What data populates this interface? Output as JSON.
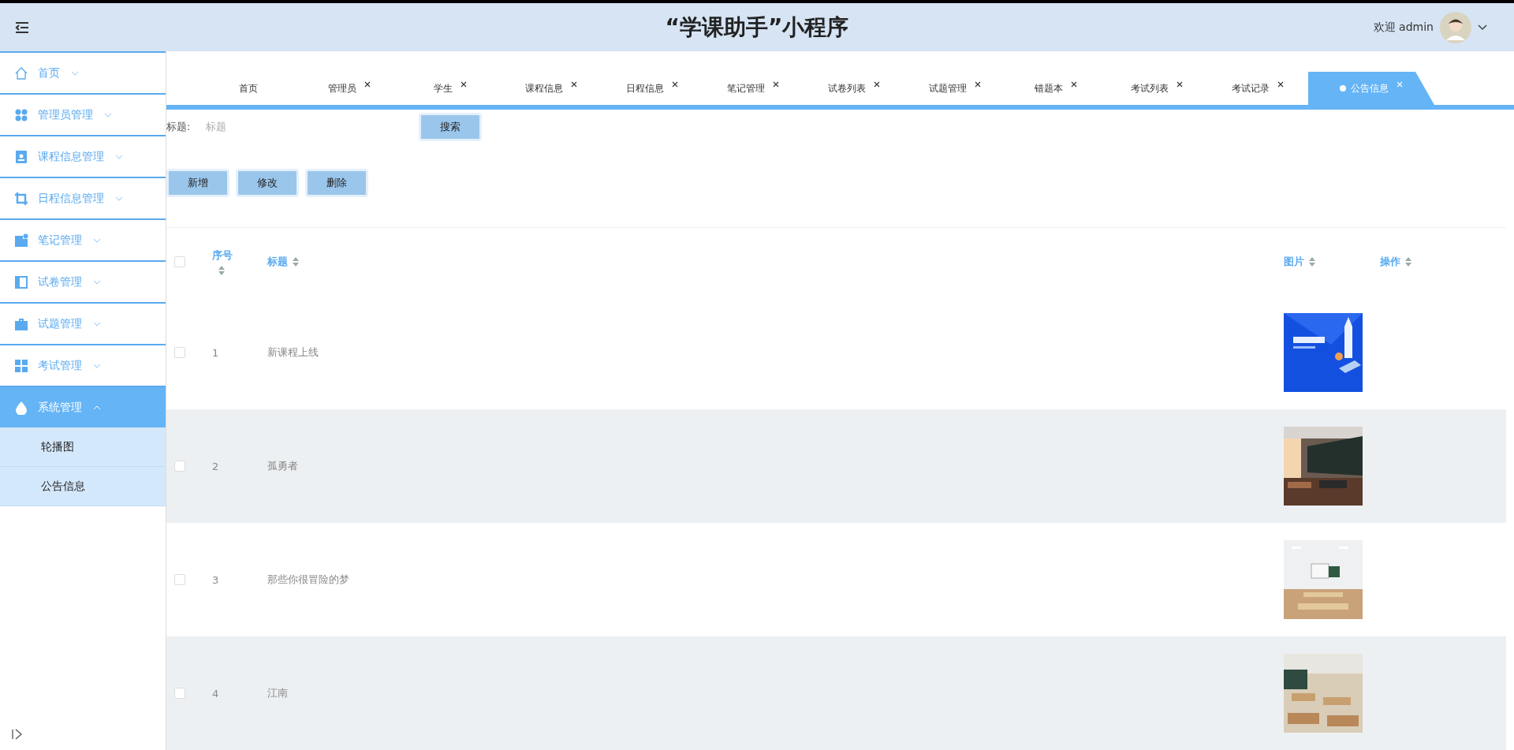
{
  "header": {
    "title": "“学课助手”小程序",
    "welcome": "欢迎 admin"
  },
  "sidebar": {
    "items": [
      {
        "label": "首页",
        "expanded": false
      },
      {
        "label": "管理员管理",
        "expanded": false
      },
      {
        "label": "课程信息管理",
        "expanded": false
      },
      {
        "label": "日程信息管理",
        "expanded": false
      },
      {
        "label": "笔记管理",
        "expanded": false
      },
      {
        "label": "试卷管理",
        "expanded": false
      },
      {
        "label": "试题管理",
        "expanded": false
      },
      {
        "label": "考试管理",
        "expanded": false
      },
      {
        "label": "系统管理",
        "expanded": true,
        "children": [
          {
            "label": "轮播图",
            "selected": false
          },
          {
            "label": "公告信息",
            "selected": false
          }
        ]
      }
    ]
  },
  "tabs": [
    {
      "label": "首页",
      "closable": false,
      "selected": false
    },
    {
      "label": "管理员",
      "closable": true,
      "selected": false
    },
    {
      "label": "学生",
      "closable": true,
      "selected": false
    },
    {
      "label": "课程信息",
      "closable": true,
      "selected": false
    },
    {
      "label": "日程信息",
      "closable": true,
      "selected": false
    },
    {
      "label": "笔记管理",
      "closable": true,
      "selected": false
    },
    {
      "label": "试卷列表",
      "closable": true,
      "selected": false
    },
    {
      "label": "试题管理",
      "closable": true,
      "selected": false
    },
    {
      "label": "错题本",
      "closable": true,
      "selected": false
    },
    {
      "label": "考试列表",
      "closable": true,
      "selected": false
    },
    {
      "label": "考试记录",
      "closable": true,
      "selected": false
    },
    {
      "label": "公告信息",
      "closable": true,
      "selected": true
    }
  ],
  "search": {
    "label": "标题:",
    "placeholder": "标题",
    "button": "搜索"
  },
  "actions": [
    "新增",
    "修改",
    "删除"
  ],
  "table": {
    "columns": [
      "序号",
      "标题",
      "图片",
      "操作"
    ],
    "all_checked": false,
    "rows": [
      {
        "index": "1",
        "title": "新课程上线",
        "checked": false
      },
      {
        "index": "2",
        "title": "孤勇者",
        "checked": false
      },
      {
        "index": "3",
        "title": "那些你很冒险的梦",
        "checked": false
      },
      {
        "index": "4",
        "title": "江南",
        "checked": false
      }
    ]
  }
}
